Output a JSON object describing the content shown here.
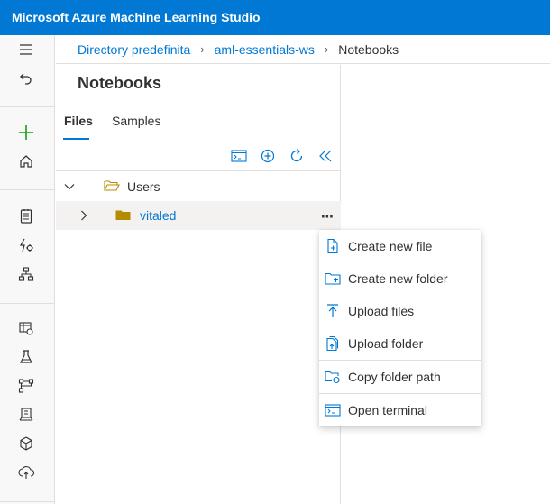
{
  "app": {
    "title": "Microsoft Azure Machine Learning Studio"
  },
  "breadcrumb": [
    {
      "label": "Directory predefinita"
    },
    {
      "label": "aml-essentials-ws"
    },
    {
      "label": "Notebooks"
    }
  ],
  "panel": {
    "title": "Notebooks",
    "tabs": [
      {
        "label": "Files",
        "active": true
      },
      {
        "label": "Samples",
        "active": false
      }
    ]
  },
  "tree": [
    {
      "label": "Users",
      "expanded": true
    },
    {
      "label": "vitaled",
      "expanded": false,
      "selected": true
    }
  ],
  "context_menu": [
    {
      "label": "Create new file",
      "icon": "new-file-icon"
    },
    {
      "label": "Create new folder",
      "icon": "new-folder-icon"
    },
    {
      "label": "Upload files",
      "icon": "upload-icon"
    },
    {
      "label": "Upload folder",
      "icon": "upload-folder-icon"
    },
    {
      "label": "Copy folder path",
      "icon": "copy-path-icon"
    },
    {
      "label": "Open terminal",
      "icon": "terminal-icon"
    }
  ],
  "colors": {
    "accent": "#0078d4",
    "folder": "#b48c00",
    "new": "#13a10e"
  }
}
